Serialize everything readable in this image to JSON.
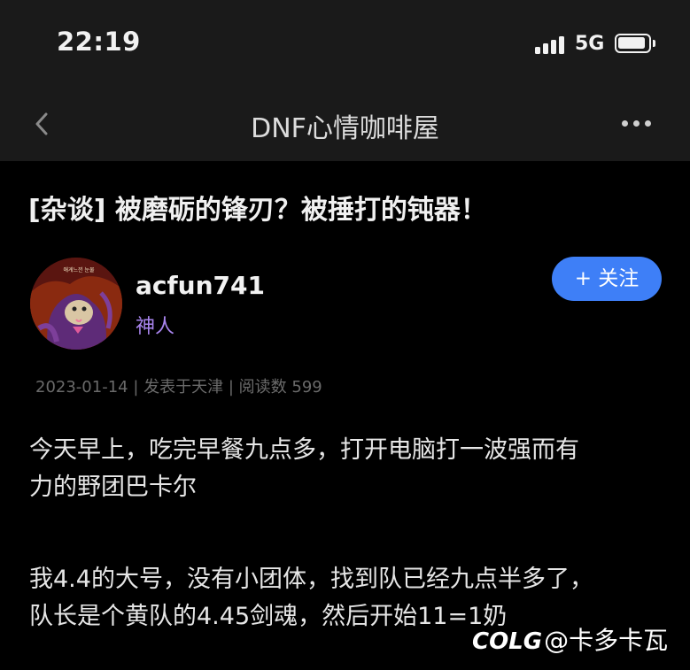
{
  "status_bar": {
    "time": "22:19",
    "network": "5G",
    "icons": [
      "signal-icon",
      "battery-icon"
    ]
  },
  "nav": {
    "title": "DNF心情咖啡屋",
    "back_icon": "chevron-left-icon",
    "more_icon": "more-dots-icon"
  },
  "post": {
    "title": "[杂谈] 被磨砺的锋刃？被捶打的钝器！",
    "author": {
      "name": "acfun741",
      "role": "神人",
      "avatar_text": "애게느낀 눈물"
    },
    "follow_label": "+ 关注",
    "meta": {
      "date": "2023-01-14",
      "location": "发表于天津",
      "views_label": "阅读数 599"
    },
    "paragraphs": [
      [
        "今天早上，吃完早餐九点多，打开电脑打一波强而有",
        "力的野团巴卡尔"
      ],
      [
        "我4.4的大号，没有小团体，找到队已经九点半多了，",
        "队长是个黄队的4.45剑魂，然后开始11=1奶"
      ]
    ]
  },
  "watermark": {
    "logo": "COLG",
    "text": "@卡多卡瓦"
  },
  "colors": {
    "background": "#000000",
    "header": "#1a1a1a",
    "accent": "#3e7ff7",
    "role": "#a985ee"
  }
}
